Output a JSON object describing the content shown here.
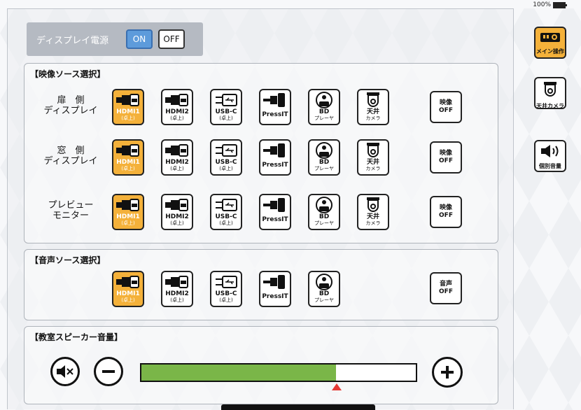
{
  "status": {
    "battery": "100%"
  },
  "power": {
    "label": "ディスプレイ電源",
    "on": "ON",
    "off": "OFF",
    "state": "ON"
  },
  "video_panel": {
    "title": "【映像ソース選択】",
    "rows": [
      {
        "label_1": "扉　側",
        "label_2": "ディスプレイ",
        "selected": "HDMI1"
      },
      {
        "label_1": "窓　側",
        "label_2": "ディスプレイ",
        "selected": "HDMI1"
      },
      {
        "label_1": "プレビュー",
        "label_2": "モニター",
        "selected": "HDMI1"
      }
    ],
    "sources": [
      {
        "line1": "HDMI1",
        "line2": "(卓上)",
        "icon": "hdmi-plug-icon"
      },
      {
        "line1": "HDMI2",
        "line2": "(卓上)",
        "icon": "hdmi-plug-icon"
      },
      {
        "line1": "USB-C",
        "line2": "(卓上)",
        "icon": "usb-icon"
      },
      {
        "line1": "PressIT",
        "line2": "",
        "icon": "pressit-icon"
      },
      {
        "line1": "BD",
        "line2": "プレーヤ",
        "icon": "disc-icon"
      },
      {
        "line1": "天井",
        "line2": "カメラ",
        "icon": "camera-icon"
      }
    ],
    "off_line1": "映像",
    "off_line2": "OFF"
  },
  "audio_panel": {
    "title": "【音声ソース選択】",
    "selected": "HDMI1",
    "sources": [
      {
        "line1": "HDMI1",
        "line2": "(卓上)",
        "icon": "hdmi-plug-icon"
      },
      {
        "line1": "HDMI2",
        "line2": "(卓上)",
        "icon": "hdmi-plug-icon"
      },
      {
        "line1": "USB-C",
        "line2": "(卓上)",
        "icon": "usb-icon"
      },
      {
        "line1": "PressIT",
        "line2": "",
        "icon": "pressit-icon"
      },
      {
        "line1": "BD",
        "line2": "プレーヤ",
        "icon": "disc-icon"
      }
    ],
    "off_line1": "音声",
    "off_line2": "OFF"
  },
  "volume_panel": {
    "title": "【教室スピーカー音量】",
    "level": 0.71,
    "marker": 0.71
  },
  "sidebar": [
    {
      "label": "メイン操作",
      "icon": "projector-icon",
      "selected": true
    },
    {
      "label": "天井カメラ",
      "icon": "camera-icon",
      "selected": false
    },
    {
      "label": "個別音量",
      "icon": "speaker-icon",
      "selected": false
    }
  ],
  "colors": {
    "selected": "#f4b13a",
    "on_button": "#5d9bdb",
    "volume_fill": "#7ab648",
    "marker": "#e53935"
  }
}
